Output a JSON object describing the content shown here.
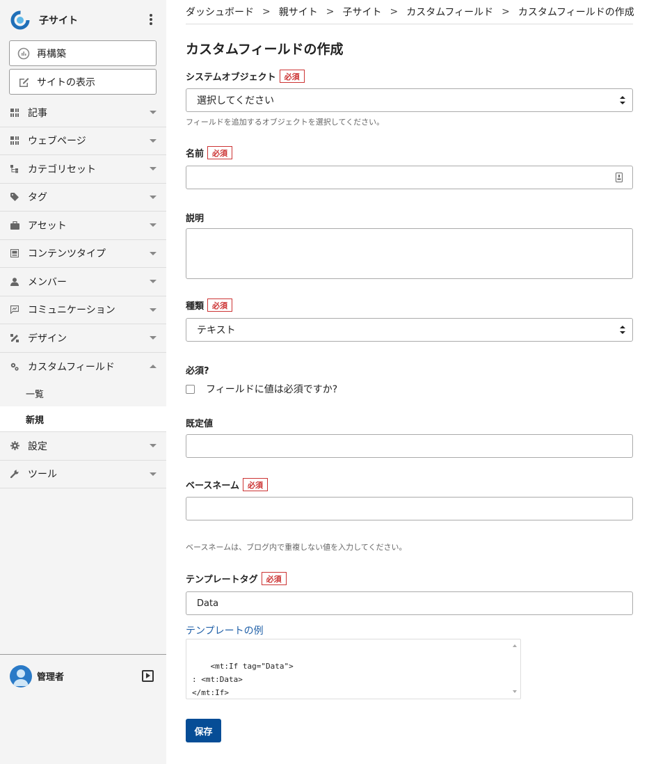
{
  "site": {
    "name": "子サイト"
  },
  "sidebar": {
    "rebuild_label": "再構築",
    "view_site_label": "サイトの表示",
    "items": [
      {
        "label": "記事",
        "icon": "entries-icon"
      },
      {
        "label": "ウェブページ",
        "icon": "pages-icon"
      },
      {
        "label": "カテゴリセット",
        "icon": "category-set-icon"
      },
      {
        "label": "タグ",
        "icon": "tag-icon"
      },
      {
        "label": "アセット",
        "icon": "asset-icon"
      },
      {
        "label": "コンテンツタイプ",
        "icon": "content-type-icon"
      },
      {
        "label": "メンバー",
        "icon": "member-icon"
      },
      {
        "label": "コミュニケーション",
        "icon": "comment-icon"
      },
      {
        "label": "デザイン",
        "icon": "design-icon"
      },
      {
        "label": "カスタムフィールド",
        "icon": "custom-field-icon"
      }
    ],
    "sub_items": [
      {
        "label": "一覧"
      },
      {
        "label": "新規"
      }
    ],
    "items_after": [
      {
        "label": "設定",
        "icon": "gear-icon"
      },
      {
        "label": "ツール",
        "icon": "wrench-icon"
      }
    ],
    "user": {
      "name": "管理者"
    }
  },
  "breadcrumb": [
    "ダッシュボード",
    "親サイト",
    "子サイト",
    "カスタムフィールド",
    "カスタムフィールドの作成"
  ],
  "breadcrumb_sep": ">",
  "page_title": "カスタムフィールドの作成",
  "required_badge": "必須",
  "form": {
    "object_label": "システムオブジェクト",
    "object_value": "選択してください",
    "object_hint": "フィールドを追加するオブジェクトを選択してください。",
    "name_label": "名前",
    "name_value": "",
    "description_label": "説明",
    "type_label": "種類",
    "type_value": "テキスト",
    "required_label": "必須?",
    "required_checkbox_label": "フィールドに値は必須ですか?",
    "default_label": "既定値",
    "basename_label": "ベースネーム",
    "basename_hint": "ベースネームは、ブログ内で重複しない値を入力してください。",
    "tag_label": "テンプレートタグ",
    "tag_value": "Data",
    "example_link": "テンプレートの例",
    "example_code": "<mt:If tag=\"Data\">\n: <mt:Data>\n</mt:If>",
    "save_label": "保存"
  },
  "colors": {
    "accent": "#064d96",
    "required": "#cc3333",
    "link": "#2060a8",
    "logo": "#1f6fb8"
  }
}
